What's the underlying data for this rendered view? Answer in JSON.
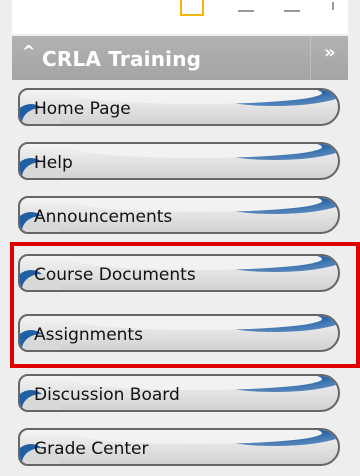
{
  "panel": {
    "caret": "^",
    "title": "CRLA Training",
    "expand": "»"
  },
  "menu": {
    "items": [
      {
        "label": "Home Page"
      },
      {
        "label": "Help"
      },
      {
        "label": "Announcements"
      },
      {
        "label": "Course Documents"
      },
      {
        "label": "Assignments"
      },
      {
        "label": "Discussion Board"
      },
      {
        "label": "Grade Center"
      }
    ]
  },
  "colors": {
    "header_bg": "#a9a9a9",
    "button_accent": "#1f5fa6",
    "highlight": "#e00000"
  }
}
